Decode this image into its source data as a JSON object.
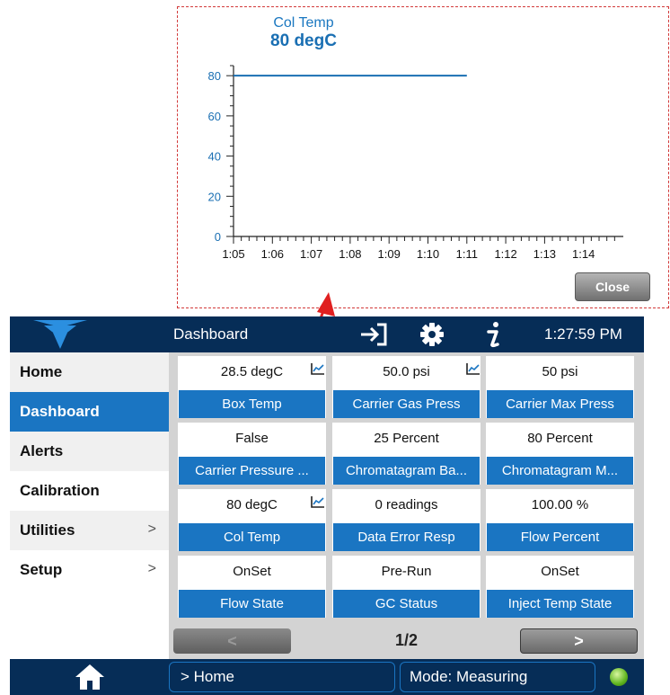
{
  "popup": {
    "title": "Col Temp",
    "value": "80 degC",
    "close_label": "Close",
    "chart_data": {
      "type": "line",
      "x_ticks": [
        "1:05",
        "1:06",
        "1:07",
        "1:08",
        "1:09",
        "1:10",
        "1:11",
        "1:12",
        "1:13",
        "1:14"
      ],
      "y_ticks": [
        0,
        20,
        40,
        60,
        80
      ],
      "ylim": [
        0,
        85
      ],
      "series": [
        {
          "x": [
            "1:05",
            "1:11"
          ],
          "values": [
            80,
            80
          ]
        }
      ],
      "line_color": "#1a6fb3"
    }
  },
  "header": {
    "title": "Dashboard",
    "time": "1:27:59 PM"
  },
  "sidebar": {
    "items": [
      {
        "label": "Home",
        "has_chevron": false,
        "active": false
      },
      {
        "label": "Dashboard",
        "has_chevron": false,
        "active": true
      },
      {
        "label": "Alerts",
        "has_chevron": false,
        "active": false
      },
      {
        "label": "Calibration",
        "has_chevron": false,
        "active": false
      },
      {
        "label": "Utilities",
        "has_chevron": true,
        "active": false
      },
      {
        "label": "Setup",
        "has_chevron": true,
        "active": false
      }
    ],
    "chevron": ">"
  },
  "tiles": [
    {
      "value": "28.5 degC",
      "label": "Box Temp",
      "trend": true
    },
    {
      "value": "50.0 psi",
      "label": "Carrier Gas Press",
      "trend": true
    },
    {
      "value": "50 psi",
      "label": "Carrier Max Press",
      "trend": false
    },
    {
      "value": "False",
      "label": "Carrier Pressure ...",
      "trend": false
    },
    {
      "value": "25 Percent",
      "label": "Chromatagram Ba...",
      "trend": false
    },
    {
      "value": "80 Percent",
      "label": "Chromatagram M...",
      "trend": false
    },
    {
      "value": "80 degC",
      "label": "Col Temp",
      "trend": true
    },
    {
      "value": "0 readings",
      "label": "Data Error Resp",
      "trend": false
    },
    {
      "value": "100.00 %",
      "label": "Flow Percent",
      "trend": false
    },
    {
      "value": "OnSet",
      "label": "Flow State",
      "trend": false
    },
    {
      "value": "Pre-Run",
      "label": "GC Status",
      "trend": false
    },
    {
      "value": "OnSet",
      "label": "Inject Temp State",
      "trend": false
    }
  ],
  "pager": {
    "prev_label": "<",
    "next_label": ">",
    "page": "1/2"
  },
  "footer": {
    "breadcrumb": "> Home",
    "mode": "Mode: Measuring"
  },
  "colors": {
    "accent": "#1a75c2",
    "header_bg": "#062d57",
    "annotation": "#e02020",
    "status_led": "#5fb51f"
  }
}
